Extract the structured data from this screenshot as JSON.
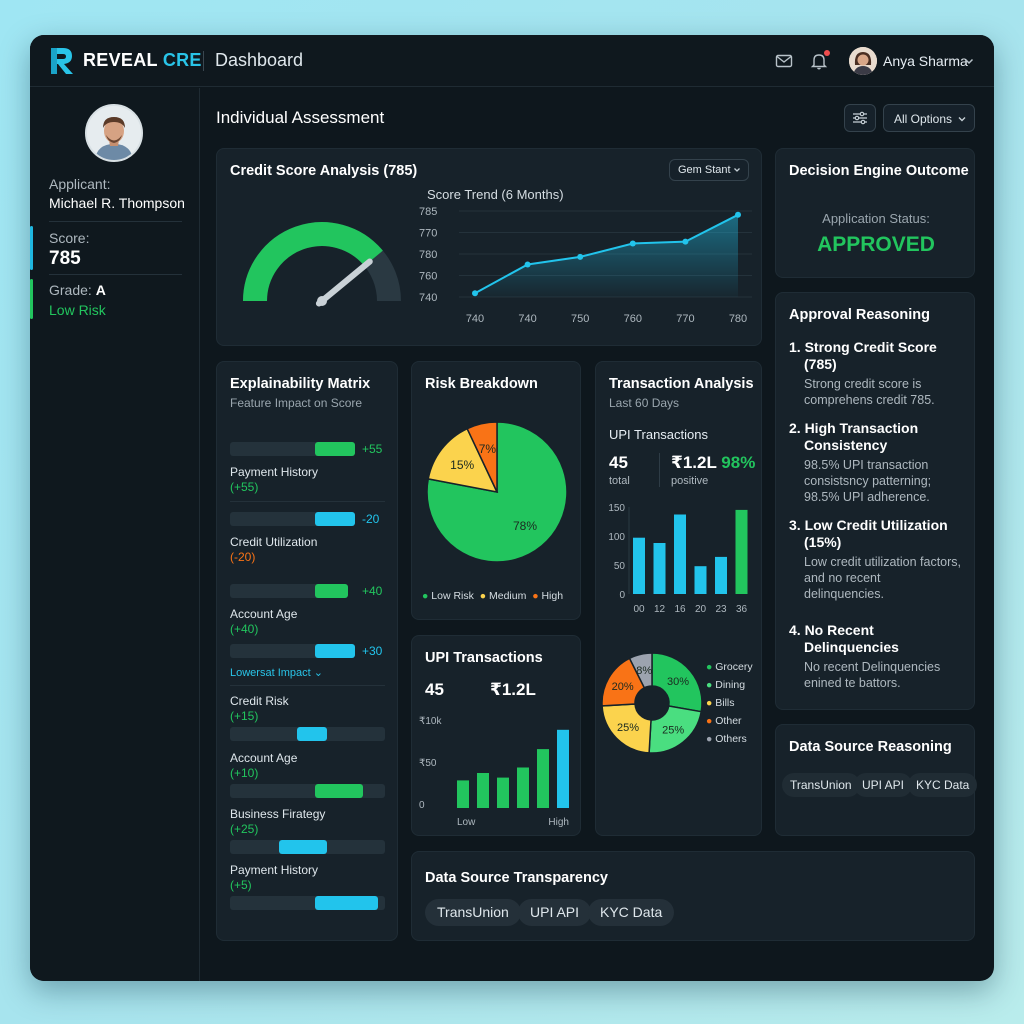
{
  "app": {
    "brand_main": "REVEAL",
    "brand_accent": "CRE",
    "page_title": "Dashboard",
    "user_name": "Anya Sharma"
  },
  "icons": {
    "logo": "logo-r-icon",
    "mail": "mail-icon",
    "bell": "bell-icon",
    "chevron": "chevron-down-icon",
    "filter": "sliders-icon"
  },
  "colors": {
    "accent": "#29c4e8",
    "green": "#22c55e",
    "yellow": "#fbd34d",
    "orange": "#f97316",
    "gray": "#9ca3af",
    "bg": "#0e171d",
    "card": "#17222a"
  },
  "sidebar": {
    "applicant_label": "Applicant:",
    "applicant_name": "Michael R. Thompson",
    "score_label": "Score:",
    "score_value": "785",
    "grade_label": "Grade:",
    "grade_value": "A",
    "risk_label": "Low Risk"
  },
  "main": {
    "title": "Individual Assessment",
    "all_options": "All Options"
  },
  "credit": {
    "title": "Credit Score Analysis (785)",
    "dropdown": "Gem Stant",
    "gauge_fraction": 0.78,
    "trend_title": "Score Trend (6 Months)"
  },
  "decision": {
    "title": "Decision Engine Outcome",
    "status_label": "Application Status:",
    "status_value": "APPROVED"
  },
  "approval": {
    "title": "Approval Reasoning",
    "items": [
      {
        "title": "1. Strong Credit Score (785)",
        "body": "Strong credit score is comprehens credit 785."
      },
      {
        "title": "2. High Transaction Consistency",
        "body": "98.5% UPI transaction consistsncy patterning; 98.5% UPI adherence."
      },
      {
        "title": "3. Low Credit Utilization (15%)",
        "body": "Low credit utilization factors, and no recent delinquencies."
      },
      {
        "title": "4. No Recent Delinquencies",
        "body": "No recent Delinquencies enined te battors."
      }
    ]
  },
  "matrix": {
    "title": "Explainability Matrix",
    "subtitle": "Feature Impact on Score",
    "top": [
      {
        "impact": "+55",
        "label": "Payment History",
        "sub": "(+55)",
        "fill": 0.55,
        "color": "green"
      },
      {
        "impact": "-20",
        "label": "Credit Utilization",
        "sub": "(-20)",
        "fill": 0.2,
        "color": "cyan"
      },
      {
        "impact": "+40",
        "label": "Account Age",
        "sub": "(+40)",
        "fill": 0.45,
        "color": "green"
      },
      {
        "impact": "+30",
        "label": "",
        "sub": "",
        "fill": 0.3,
        "color": "cyan"
      }
    ],
    "lower_label": "Lowersat Impact",
    "lower": [
      {
        "label": "Credit Risk",
        "sub": "(+15)",
        "color": "cyan"
      },
      {
        "label": "Account Age",
        "sub": "(+10)",
        "color": "green"
      },
      {
        "label": "Business Firategy",
        "sub": "(+25)",
        "color": "cyan"
      },
      {
        "label": "Payment History",
        "sub": "(+5)",
        "color": "cyan"
      }
    ]
  },
  "risk": {
    "title": "Risk Breakdown",
    "legend": [
      "Low Risk",
      "Medium",
      "High"
    ]
  },
  "upi_small": {
    "title": "UPI Transactions",
    "count": "45",
    "amount": "₹1.2L"
  },
  "transactions": {
    "title": "Transaction Analysis",
    "subtitle": "Last 60 Days",
    "upi_label": "UPI Transactions",
    "count": "45",
    "count_label": "total",
    "amount": "₹1.2L",
    "percent": "98%",
    "amount_label": "positive"
  },
  "datasource_reason": {
    "title": "Data Source Reasoning",
    "chips": [
      "TransUnion",
      "UPI API",
      "KYC Data"
    ]
  },
  "transparency": {
    "title": "Data Source Transparency",
    "chips": [
      "TransUnion",
      "UPI API",
      "KYC Data"
    ]
  },
  "chart_data": [
    {
      "type": "line",
      "title": "Score Trend (6 Months)",
      "y_ticks": [
        "785",
        "770",
        "780",
        "760",
        "740"
      ],
      "x_ticks": [
        "740",
        "740",
        "750",
        "760",
        "770",
        "780"
      ],
      "series": [
        {
          "values": [
            742,
            757,
            761,
            768,
            769,
            783
          ]
        }
      ],
      "ylim": [
        740,
        785
      ]
    },
    {
      "type": "pie",
      "title": "Risk Breakdown",
      "labels": [
        "Low Risk",
        "Medium",
        "High"
      ],
      "values": [
        78,
        15,
        7
      ],
      "slice_labels": [
        "78%",
        "15%",
        "7%"
      ],
      "colors": [
        "#22c55e",
        "#fbd34d",
        "#f97316"
      ]
    },
    {
      "type": "bar",
      "title": "UPI Transactions",
      "y_ticks": [
        "₹10k",
        "₹50",
        "0"
      ],
      "x_ticks": [
        "Low",
        "High"
      ],
      "values": [
        30,
        38,
        33,
        44,
        64,
        85
      ],
      "colors": [
        "#22c55e",
        "#22c55e",
        "#22c55e",
        "#22c55e",
        "#22c55e",
        "#22c4ec"
      ],
      "ylim": [
        0,
        100
      ]
    },
    {
      "type": "bar",
      "title": "Transaction Analysis",
      "categories": [
        "00",
        "12",
        "16",
        "20",
        "23",
        "36"
      ],
      "y_ticks": [
        "150",
        "100",
        "50",
        "0"
      ],
      "values": [
        97,
        88,
        137,
        48,
        64,
        145
      ],
      "colors": [
        "#22c4ec",
        "#22c4ec",
        "#22c4ec",
        "#22c4ec",
        "#22c4ec",
        "#22c55e"
      ],
      "ylim": [
        0,
        150
      ]
    },
    {
      "type": "pie",
      "title": "Spending Categories",
      "labels": [
        "Grocery",
        "Dining",
        "Bills",
        "Other",
        "Others"
      ],
      "values": [
        30,
        25,
        25,
        20,
        8
      ],
      "slice_labels": [
        "30%",
        "25%",
        "25%",
        "20%",
        "8%"
      ],
      "colors": [
        "#22c55e",
        "#4ade80",
        "#fbd34d",
        "#f97316",
        "#9ca3af"
      ]
    }
  ]
}
